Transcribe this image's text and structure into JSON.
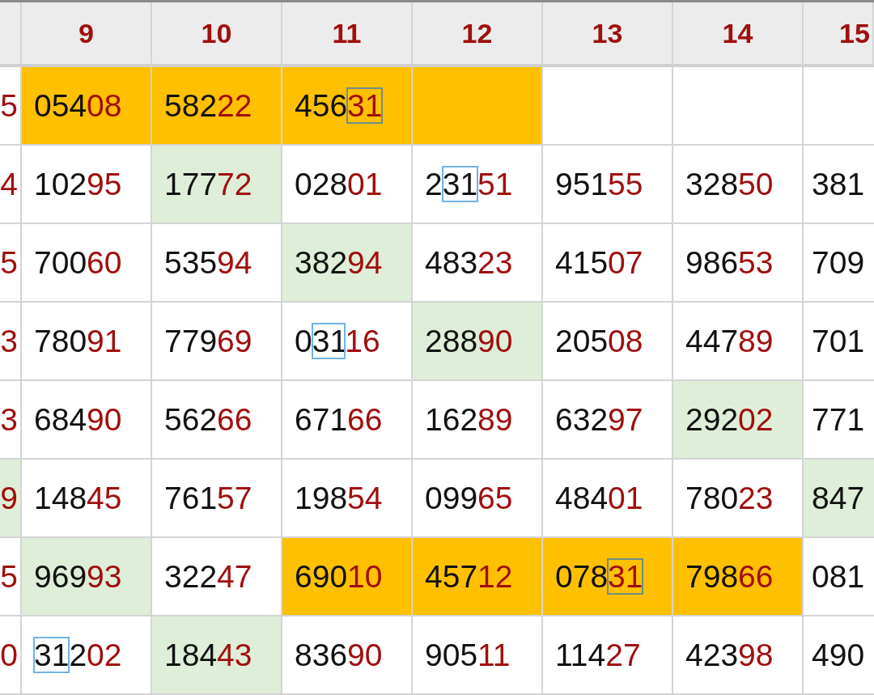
{
  "table": {
    "columns": [
      "",
      "9",
      "10",
      "11",
      "12",
      "13",
      "14",
      "15"
    ],
    "rows": [
      {
        "cells": [
          {
            "parts": [
              {
                "text": "5",
                "red": true,
                "boxed": false
              }
            ]
          },
          {
            "color": "#ffc000",
            "parts": [
              {
                "text": "054",
                "red": false,
                "boxed": false
              },
              {
                "text": "08",
                "red": true,
                "boxed": false
              }
            ]
          },
          {
            "color": "#ffc000",
            "parts": [
              {
                "text": "582",
                "red": false,
                "boxed": false
              },
              {
                "text": "22",
                "red": true,
                "boxed": false
              }
            ]
          },
          {
            "color": "#ffc000",
            "parts": [
              {
                "text": "456",
                "red": false,
                "boxed": false
              },
              {
                "text": "31",
                "red": true,
                "boxed": true
              }
            ]
          },
          {
            "color": "#ffc000"
          },
          {},
          {},
          {}
        ]
      },
      {
        "cells": [
          {
            "parts": [
              {
                "text": "4",
                "red": true,
                "boxed": false
              }
            ]
          },
          {
            "parts": [
              {
                "text": "102",
                "red": false,
                "boxed": false
              },
              {
                "text": "95",
                "red": true,
                "boxed": false
              }
            ]
          },
          {
            "color": "#deeed8",
            "parts": [
              {
                "text": "177",
                "red": false,
                "boxed": false
              },
              {
                "text": "72",
                "red": true,
                "boxed": false
              }
            ]
          },
          {
            "parts": [
              {
                "text": "028",
                "red": false,
                "boxed": false
              },
              {
                "text": "01",
                "red": true,
                "boxed": false
              }
            ]
          },
          {
            "parts": [
              {
                "text": "2",
                "red": false,
                "boxed": false
              },
              {
                "text": "31",
                "red": false,
                "boxed": true
              },
              {
                "text": "51",
                "red": true,
                "boxed": false
              }
            ]
          },
          {
            "parts": [
              {
                "text": "951",
                "red": false,
                "boxed": false
              },
              {
                "text": "55",
                "red": true,
                "boxed": false
              }
            ]
          },
          {
            "parts": [
              {
                "text": "328",
                "red": false,
                "boxed": false
              },
              {
                "text": "50",
                "red": true,
                "boxed": false
              }
            ]
          },
          {
            "parts": [
              {
                "text": "381",
                "red": false,
                "boxed": false
              }
            ]
          }
        ]
      },
      {
        "cells": [
          {
            "parts": [
              {
                "text": "5",
                "red": true,
                "boxed": false
              }
            ]
          },
          {
            "parts": [
              {
                "text": "700",
                "red": false,
                "boxed": false
              },
              {
                "text": "60",
                "red": true,
                "boxed": false
              }
            ]
          },
          {
            "parts": [
              {
                "text": "535",
                "red": false,
                "boxed": false
              },
              {
                "text": "94",
                "red": true,
                "boxed": false
              }
            ]
          },
          {
            "color": "#deeed8",
            "parts": [
              {
                "text": "382",
                "red": false,
                "boxed": false
              },
              {
                "text": "94",
                "red": true,
                "boxed": false
              }
            ]
          },
          {
            "parts": [
              {
                "text": "483",
                "red": false,
                "boxed": false
              },
              {
                "text": "23",
                "red": true,
                "boxed": false
              }
            ]
          },
          {
            "parts": [
              {
                "text": "415",
                "red": false,
                "boxed": false
              },
              {
                "text": "07",
                "red": true,
                "boxed": false
              }
            ]
          },
          {
            "parts": [
              {
                "text": "986",
                "red": false,
                "boxed": false
              },
              {
                "text": "53",
                "red": true,
                "boxed": false
              }
            ]
          },
          {
            "parts": [
              {
                "text": "709",
                "red": false,
                "boxed": false
              }
            ]
          }
        ]
      },
      {
        "cells": [
          {
            "parts": [
              {
                "text": "3",
                "red": true,
                "boxed": false
              }
            ]
          },
          {
            "parts": [
              {
                "text": "780",
                "red": false,
                "boxed": false
              },
              {
                "text": "91",
                "red": true,
                "boxed": false
              }
            ]
          },
          {
            "parts": [
              {
                "text": "779",
                "red": false,
                "boxed": false
              },
              {
                "text": "69",
                "red": true,
                "boxed": false
              }
            ]
          },
          {
            "parts": [
              {
                "text": "0",
                "red": false,
                "boxed": false
              },
              {
                "text": "31",
                "red": false,
                "boxed": true
              },
              {
                "text": "16",
                "red": true,
                "boxed": false
              }
            ]
          },
          {
            "color": "#deeed8",
            "parts": [
              {
                "text": "288",
                "red": false,
                "boxed": false
              },
              {
                "text": "90",
                "red": true,
                "boxed": false
              }
            ]
          },
          {
            "parts": [
              {
                "text": "205",
                "red": false,
                "boxed": false
              },
              {
                "text": "08",
                "red": true,
                "boxed": false
              }
            ]
          },
          {
            "parts": [
              {
                "text": "447",
                "red": false,
                "boxed": false
              },
              {
                "text": "89",
                "red": true,
                "boxed": false
              }
            ]
          },
          {
            "parts": [
              {
                "text": "701",
                "red": false,
                "boxed": false
              }
            ]
          }
        ]
      },
      {
        "cells": [
          {
            "parts": [
              {
                "text": "3",
                "red": true,
                "boxed": false
              }
            ]
          },
          {
            "parts": [
              {
                "text": "684",
                "red": false,
                "boxed": false
              },
              {
                "text": "90",
                "red": true,
                "boxed": false
              }
            ]
          },
          {
            "parts": [
              {
                "text": "562",
                "red": false,
                "boxed": false
              },
              {
                "text": "66",
                "red": true,
                "boxed": false
              }
            ]
          },
          {
            "parts": [
              {
                "text": "671",
                "red": false,
                "boxed": false
              },
              {
                "text": "66",
                "red": true,
                "boxed": false
              }
            ]
          },
          {
            "parts": [
              {
                "text": "162",
                "red": false,
                "boxed": false
              },
              {
                "text": "89",
                "red": true,
                "boxed": false
              }
            ]
          },
          {
            "parts": [
              {
                "text": "632",
                "red": false,
                "boxed": false
              },
              {
                "text": "97",
                "red": true,
                "boxed": false
              }
            ]
          },
          {
            "color": "#deeed8",
            "parts": [
              {
                "text": "292",
                "red": false,
                "boxed": false
              },
              {
                "text": "02",
                "red": true,
                "boxed": false
              }
            ]
          },
          {
            "parts": [
              {
                "text": "771",
                "red": false,
                "boxed": false
              }
            ]
          }
        ]
      },
      {
        "cells": [
          {
            "color": "#deeed8",
            "parts": [
              {
                "text": "9",
                "red": true,
                "boxed": false
              }
            ]
          },
          {
            "parts": [
              {
                "text": "148",
                "red": false,
                "boxed": false
              },
              {
                "text": "45",
                "red": true,
                "boxed": false
              }
            ]
          },
          {
            "parts": [
              {
                "text": "761",
                "red": false,
                "boxed": false
              },
              {
                "text": "57",
                "red": true,
                "boxed": false
              }
            ]
          },
          {
            "parts": [
              {
                "text": "198",
                "red": false,
                "boxed": false
              },
              {
                "text": "54",
                "red": true,
                "boxed": false
              }
            ]
          },
          {
            "parts": [
              {
                "text": "099",
                "red": false,
                "boxed": false
              },
              {
                "text": "65",
                "red": true,
                "boxed": false
              }
            ]
          },
          {
            "parts": [
              {
                "text": "484",
                "red": false,
                "boxed": false
              },
              {
                "text": "01",
                "red": true,
                "boxed": false
              }
            ]
          },
          {
            "parts": [
              {
                "text": "780",
                "red": false,
                "boxed": false
              },
              {
                "text": "23",
                "red": true,
                "boxed": false
              }
            ]
          },
          {
            "color": "#deeed8",
            "parts": [
              {
                "text": "847",
                "red": false,
                "boxed": false
              }
            ]
          }
        ]
      },
      {
        "cells": [
          {
            "parts": [
              {
                "text": "5",
                "red": true,
                "boxed": false
              }
            ]
          },
          {
            "color": "#deeed8",
            "parts": [
              {
                "text": "969",
                "red": false,
                "boxed": false
              },
              {
                "text": "93",
                "red": true,
                "boxed": false
              }
            ]
          },
          {
            "parts": [
              {
                "text": "322",
                "red": false,
                "boxed": false
              },
              {
                "text": "47",
                "red": true,
                "boxed": false
              }
            ]
          },
          {
            "color": "#ffc000",
            "parts": [
              {
                "text": "690",
                "red": false,
                "boxed": false
              },
              {
                "text": "10",
                "red": true,
                "boxed": false
              }
            ]
          },
          {
            "color": "#ffc000",
            "parts": [
              {
                "text": "457",
                "red": false,
                "boxed": false
              },
              {
                "text": "12",
                "red": true,
                "boxed": false
              }
            ]
          },
          {
            "color": "#ffc000",
            "parts": [
              {
                "text": "078",
                "red": false,
                "boxed": false
              },
              {
                "text": "31",
                "red": true,
                "boxed": true
              }
            ]
          },
          {
            "color": "#ffc000",
            "parts": [
              {
                "text": "798",
                "red": false,
                "boxed": false
              },
              {
                "text": "66",
                "red": true,
                "boxed": false
              }
            ]
          },
          {
            "parts": [
              {
                "text": "081",
                "red": false,
                "boxed": false
              }
            ]
          }
        ]
      },
      {
        "cells": [
          {
            "parts": [
              {
                "text": "0",
                "red": true,
                "boxed": false
              }
            ]
          },
          {
            "parts": [
              {
                "text": "31",
                "red": false,
                "boxed": true
              },
              {
                "text": "2",
                "red": false,
                "boxed": false
              },
              {
                "text": "02",
                "red": true,
                "boxed": false
              }
            ]
          },
          {
            "color": "#deeed8",
            "parts": [
              {
                "text": "184",
                "red": false,
                "boxed": false
              },
              {
                "text": "43",
                "red": true,
                "boxed": false
              }
            ]
          },
          {
            "parts": [
              {
                "text": "836",
                "red": false,
                "boxed": false
              },
              {
                "text": "90",
                "red": true,
                "boxed": false
              }
            ]
          },
          {
            "parts": [
              {
                "text": "905",
                "red": false,
                "boxed": false
              },
              {
                "text": "11",
                "red": true,
                "boxed": false
              }
            ]
          },
          {
            "parts": [
              {
                "text": "114",
                "red": false,
                "boxed": false
              },
              {
                "text": "27",
                "red": true,
                "boxed": false
              }
            ]
          },
          {
            "parts": [
              {
                "text": "423",
                "red": false,
                "boxed": false
              },
              {
                "text": "98",
                "red": true,
                "boxed": false
              }
            ]
          },
          {
            "parts": [
              {
                "text": "490",
                "red": false,
                "boxed": false
              }
            ]
          }
        ]
      }
    ]
  }
}
